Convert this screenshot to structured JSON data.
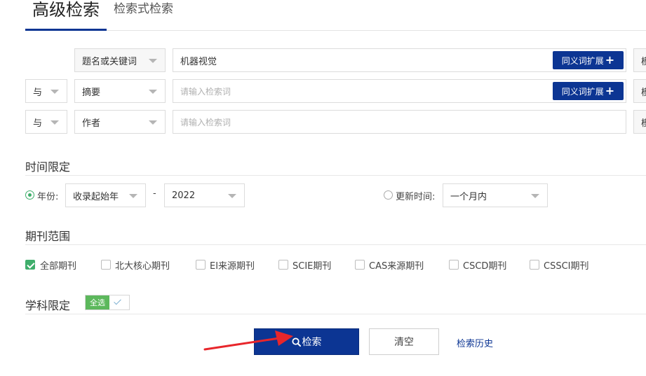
{
  "tabs": {
    "active": "高级检索",
    "inactive": "检索式检索"
  },
  "rows": [
    {
      "field": "题名或关键词",
      "value": "机器视觉",
      "button": "同义词扩展",
      "extra": "模"
    },
    {
      "logic": "与",
      "field": "摘要",
      "placeholder": "请输入检索词",
      "button": "同义词扩展",
      "extra": "模"
    },
    {
      "logic": "与",
      "field": "作者",
      "placeholder": "请输入检索词",
      "extra": "模"
    }
  ],
  "time": {
    "title": "时间限定",
    "year_label": "年份:",
    "year_from": "收录起始年",
    "dash": "-",
    "year_to": "2022",
    "update_label": "更新时间:",
    "update_value": "一个月内"
  },
  "journals": {
    "title": "期刊范围",
    "items": [
      "全部期刊",
      "北大核心期刊",
      "EI来源期刊",
      "SCIE期刊",
      "CAS来源期刊",
      "CSCD期刊",
      "CSSCI期刊"
    ],
    "checked": [
      true,
      false,
      false,
      false,
      false,
      false,
      false
    ]
  },
  "subject": {
    "title": "学科限定",
    "all_label": "全选"
  },
  "actions": {
    "search": "检索",
    "clear": "清空",
    "history": "检索历史"
  },
  "colors": {
    "primary": "#0c3593",
    "green": "#3fae6b",
    "arrow": "#e8262b"
  }
}
